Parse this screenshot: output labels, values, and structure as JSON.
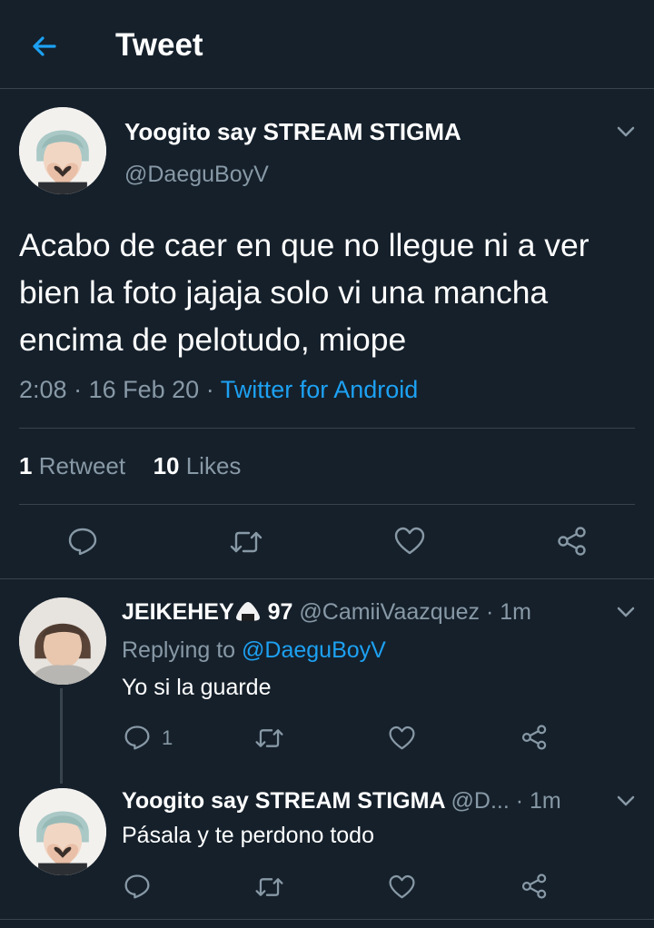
{
  "header": {
    "title": "Tweet"
  },
  "main_tweet": {
    "name": "Yoogito say STREAM STIGMA",
    "handle": "@DaeguBoyV",
    "text": "Acabo de caer en que no llegue ni a ver bien la foto jajaja solo vi una mancha encima de pelotudo, miope",
    "time": "2:08",
    "date": "16 Feb 20",
    "source": "Twitter for Android",
    "retweets_count": "1",
    "retweets_label": "Retweet",
    "likes_count": "10",
    "likes_label": "Likes"
  },
  "replies": [
    {
      "name": "JEIKEHEY",
      "name_suffix": "97",
      "handle": "@CamiiVaazquez",
      "time": "1m",
      "replying_prefix": "Replying to",
      "replying_to": "@DaeguBoyV",
      "text": "Yo si la guarde",
      "reply_count": "1"
    },
    {
      "name": "Yoogito say STREAM STIGMA",
      "handle": "@D...",
      "time": "1m",
      "text": "Pásala y te perdono todo"
    }
  ],
  "icons": {
    "back": "arrow-left-icon",
    "more": "chevron-down-icon",
    "reply": "comment-icon",
    "retweet": "retweet-icon",
    "like": "heart-icon",
    "share": "share-icon",
    "emoji": "onigiri-icon"
  },
  "colors": {
    "background": "#15202b",
    "accent": "#1da1f2",
    "secondary_text": "#8899a6",
    "divider": "#38444d"
  }
}
